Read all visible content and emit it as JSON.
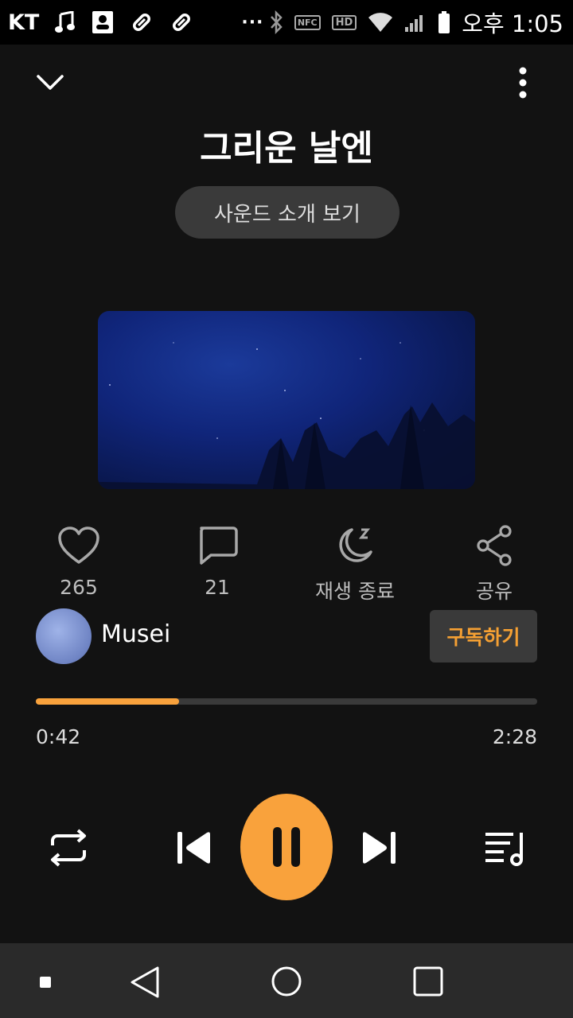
{
  "status_bar": {
    "carrier": "KT",
    "time": "오후 1:05",
    "nfc": "NFC",
    "hd": "HD",
    "overflow": "···"
  },
  "header": {
    "title": "그리운 날엔",
    "sound_intro_button": "사운드 소개 보기"
  },
  "actions": {
    "like_count": "265",
    "comment_count": "21",
    "sleep_timer_label": "재생 종료",
    "share_label": "공유"
  },
  "creator": {
    "name": "Musei",
    "subscribe_label": "구독하기"
  },
  "playback": {
    "current_time": "0:42",
    "total_time": "2:28",
    "progress_fraction": 0.285,
    "state": "playing"
  },
  "colors": {
    "accent": "#f9a23c",
    "background": "#121212"
  },
  "icons": {
    "collapse": "chevron-down-icon",
    "more": "more-vertical-icon",
    "like": "heart-icon",
    "comment": "comment-icon",
    "sleep": "moon-sleep-icon",
    "share": "share-icon",
    "repeat": "repeat-icon",
    "previous": "skip-previous-icon",
    "pause": "pause-icon",
    "next": "skip-next-icon",
    "playlist": "playlist-icon"
  }
}
